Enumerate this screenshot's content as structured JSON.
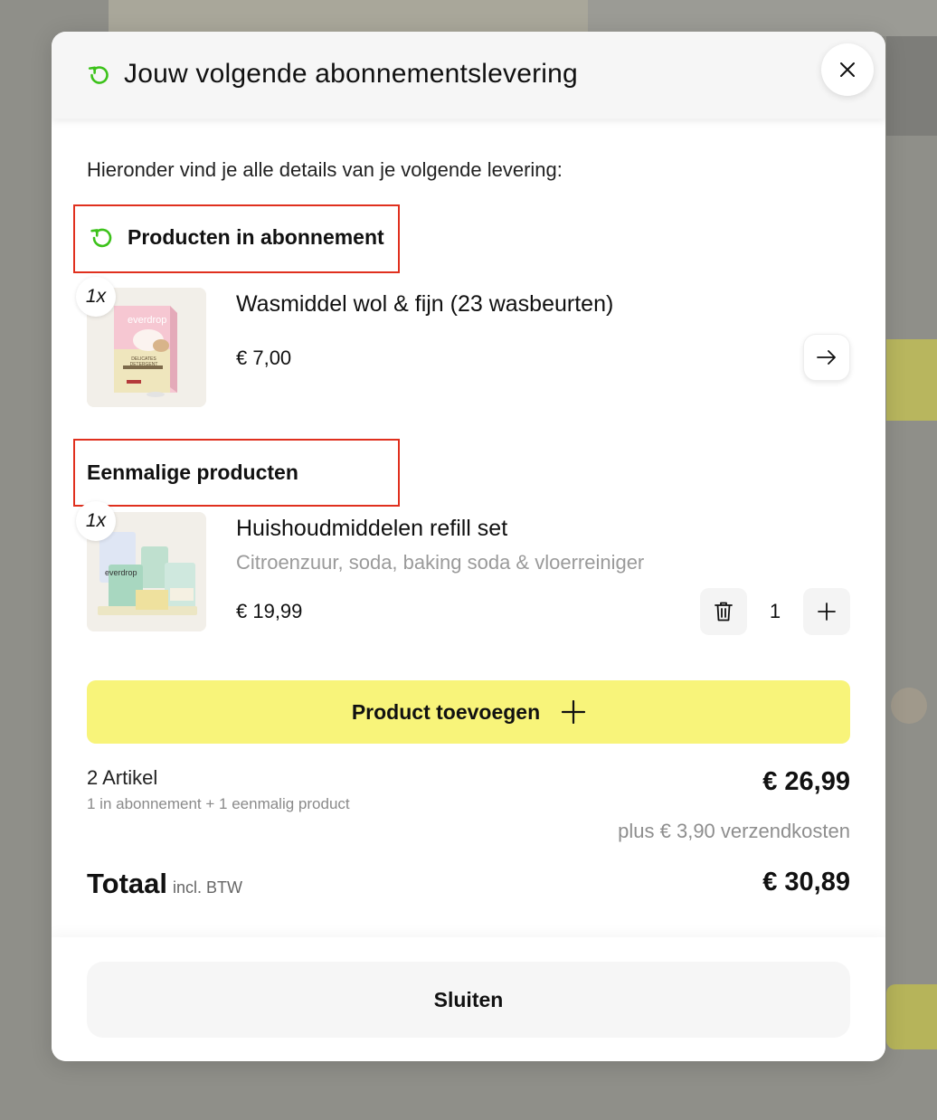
{
  "modal": {
    "title": "Jouw volgende abonnementslevering",
    "intro": "Hieronder vind je alle details van je volgende levering:"
  },
  "subscription": {
    "heading": "Producten in abonnement",
    "product": {
      "quantity": "1x",
      "name": "Wasmiddel wol & fijn (23 wasbeurten)",
      "price": "€ 7,00",
      "image_text": "everdrop",
      "image_label": "DELICATES DETERGENT"
    }
  },
  "one_time": {
    "heading": "Eenmalige producten",
    "product": {
      "quantity": "1x",
      "name": "Huishoudmiddelen refill set",
      "subtitle": "Citroenzuur, soda, baking soda & vloerreiniger",
      "price": "€ 19,99",
      "stepper_value": "1",
      "image_text": "everdrop"
    }
  },
  "add_button": {
    "label": "Product toevoegen"
  },
  "summary": {
    "items": "2 Artikel",
    "items_detail": "1 in abonnement + 1 eenmalig product",
    "subtotal": "€ 26,99",
    "shipping": "plus € 3,90 verzendkosten",
    "total_label": "Totaal",
    "total_incl": "incl. BTW",
    "total": "€ 30,89"
  },
  "footer": {
    "close_label": "Sluiten"
  },
  "colors": {
    "accent_green": "#3cc21a",
    "highlight_red": "#e0301e",
    "add_button_yellow": "#f8f47a"
  },
  "icons": {
    "subscription": "refresh-icon",
    "close": "close-icon",
    "arrow": "arrow-right-icon",
    "delete": "trash-icon",
    "add": "plus-icon"
  }
}
